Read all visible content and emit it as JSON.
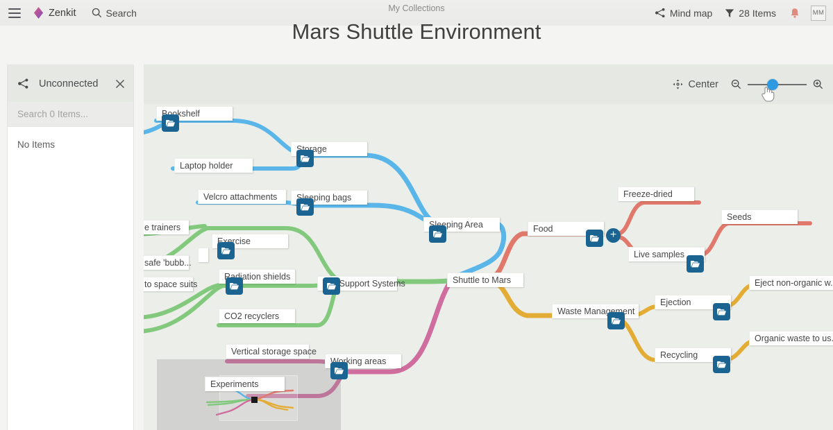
{
  "topbar": {
    "menu_icon": "hamburger-icon",
    "brand": "Zenkit",
    "brand_logo_icon": "zenkit-diamond-logo",
    "search_label": "Search",
    "search_icon": "search-icon",
    "breadcrumb": "My Collections",
    "view_label": "Mind map",
    "view_icon": "mind-map-icon",
    "filter_label": "28 Items",
    "filter_icon": "filter-icon",
    "bell_icon": "notification-bell-icon",
    "avatar_initials": "MM"
  },
  "page": {
    "title": "Mars Shuttle Environment"
  },
  "sidebar": {
    "title": "Unconnected",
    "title_icon": "mind-map-icon",
    "close_icon": "close-icon",
    "search_placeholder": "Search 0 Items...",
    "search_value": "",
    "empty_label": "No Items"
  },
  "canvas_toolbar": {
    "center_label": "Center",
    "center_icon": "center-crosshair-icon",
    "zoom_out_icon": "zoom-out-icon",
    "zoom_in_icon": "zoom-in-icon",
    "zoom_percent": 42
  },
  "colors": {
    "accent_blue": "#2e9ae2",
    "branch_blue": "#5ab6e8",
    "branch_green": "#82c97d",
    "branch_pink": "#cf6d9e",
    "branch_salmon": "#e0796c",
    "branch_gold": "#e3ad35",
    "folder_badge": "#1b6390",
    "canvas_bg": "#eceeea",
    "toolbar_bg": "#e6e8e4"
  },
  "mindmap": {
    "root": {
      "label": "Shuttle to Mars"
    },
    "nodes": [
      {
        "id": "bookshelf",
        "label": "Bookshelf",
        "branch": "blue",
        "folder": true
      },
      {
        "id": "laptop-holder",
        "label": "Laptop holder",
        "branch": "blue",
        "folder": false
      },
      {
        "id": "storage",
        "label": "Storage",
        "branch": "blue",
        "folder": true
      },
      {
        "id": "velcro",
        "label": "Velcro attachments",
        "branch": "blue",
        "folder": false
      },
      {
        "id": "sleeping-bags",
        "label": "Sleeping bags",
        "branch": "blue",
        "folder": true
      },
      {
        "id": "sleeping-area",
        "label": "Sleeping Area",
        "branch": "blue",
        "folder": true
      },
      {
        "id": "trainers",
        "label": "e trainers",
        "branch": "green",
        "folder": false
      },
      {
        "id": "blank-node",
        "label": "",
        "branch": "green",
        "folder": false
      },
      {
        "id": "exercise",
        "label": "Exercise",
        "branch": "green",
        "folder": true
      },
      {
        "id": "safe-bubble",
        "label": "safe 'bubb...",
        "branch": "green",
        "folder": false
      },
      {
        "id": "radiation",
        "label": "Radiation shields",
        "branch": "green",
        "folder": true
      },
      {
        "id": "space-suits",
        "label": "to space suits",
        "branch": "green",
        "folder": false
      },
      {
        "id": "co2",
        "label": "CO2 recyclers",
        "branch": "green",
        "folder": false
      },
      {
        "id": "life-support",
        "label": "Life Support Systems",
        "branch": "green",
        "folder": true
      },
      {
        "id": "food",
        "label": "Food",
        "branch": "salmon",
        "folder": true
      },
      {
        "id": "freeze-dried",
        "label": "Freeze-dried",
        "branch": "salmon",
        "folder": false
      },
      {
        "id": "live-samples",
        "label": "Live samples",
        "branch": "salmon",
        "folder": true
      },
      {
        "id": "seeds",
        "label": "Seeds",
        "branch": "salmon",
        "folder": false
      },
      {
        "id": "waste-management",
        "label": "Waste Management",
        "branch": "gold",
        "folder": true
      },
      {
        "id": "ejection",
        "label": "Ejection",
        "branch": "gold",
        "folder": true
      },
      {
        "id": "eject-nonorganic",
        "label": "Eject non-organic w...",
        "branch": "gold",
        "folder": false
      },
      {
        "id": "recycling",
        "label": "Recycling",
        "branch": "gold",
        "folder": true
      },
      {
        "id": "organic-waste",
        "label": "Organic waste to us...",
        "branch": "gold",
        "folder": false
      },
      {
        "id": "vertical-storage",
        "label": "Vertical storage space",
        "branch": "pink",
        "folder": false
      },
      {
        "id": "working-areas",
        "label": "Working areas",
        "branch": "pink",
        "folder": true
      },
      {
        "id": "experiments",
        "label": "Experiments",
        "branch": "pink",
        "folder": false
      }
    ],
    "add_button_label": "+"
  }
}
